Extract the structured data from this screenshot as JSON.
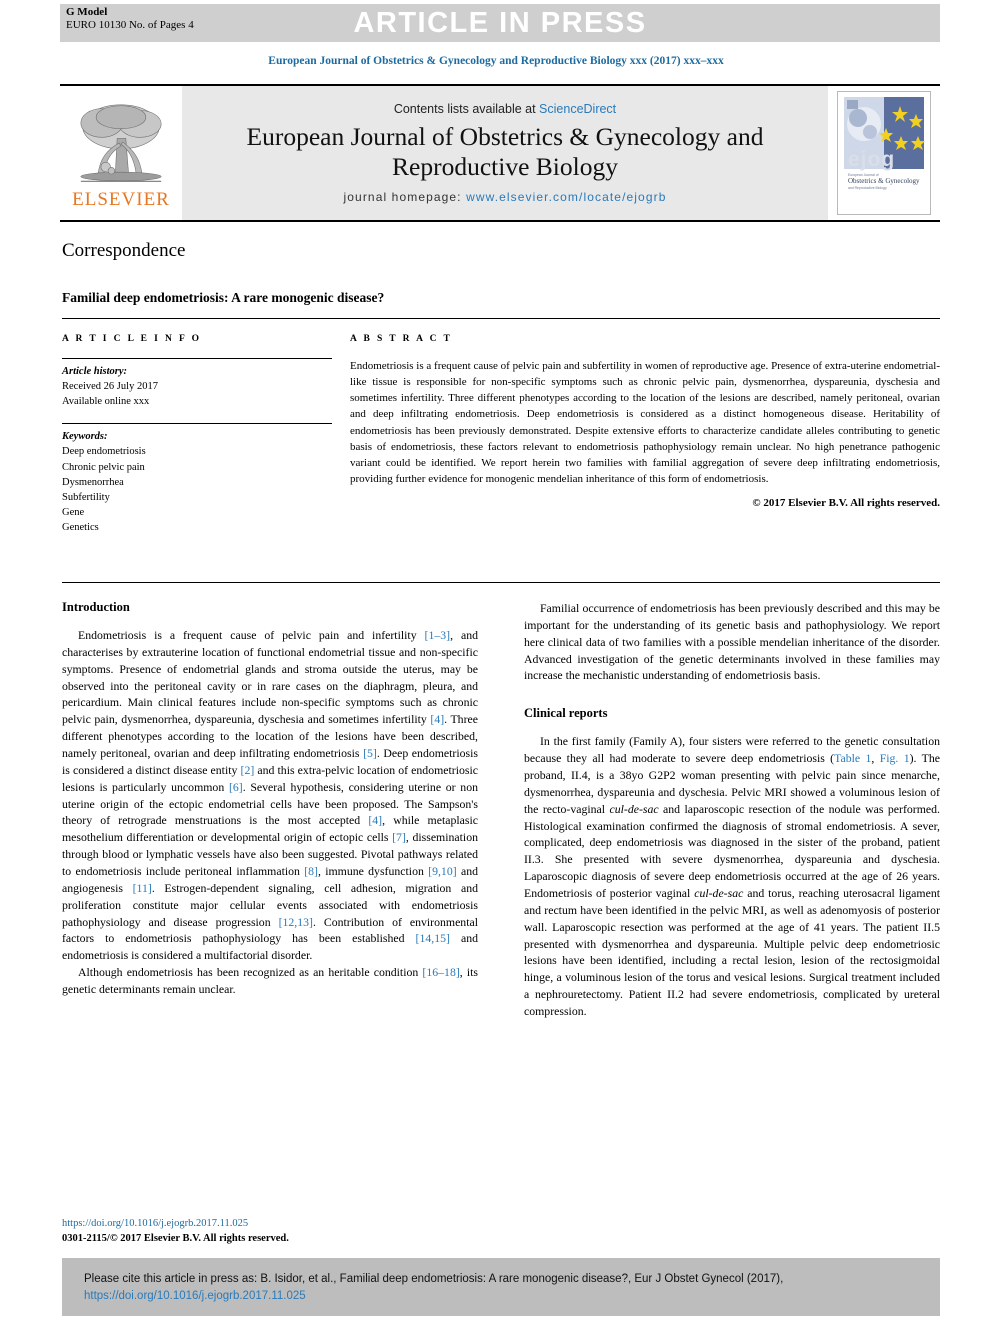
{
  "header": {
    "g_model_line1": "G Model",
    "g_model_line2": "EURO 10130 No. of Pages 4",
    "press_banner": "ARTICLE IN PRESS",
    "running_head": "European Journal of Obstetrics & Gynecology and Reproductive Biology xxx (2017) xxx–xxx"
  },
  "masthead": {
    "contents_prefix": "Contents lists available at ",
    "contents_link": "ScienceDirect",
    "journal_title_line1": "European Journal of Obstetrics & Gynecology and",
    "journal_title_line2": "Reproductive Biology",
    "homepage_label": "journal homepage: ",
    "homepage_url": "www.elsevier.com/locate/ejogrb",
    "publisher_wordmark": "ELSEVIER",
    "cover_wordmark": "ejog",
    "cover_sub1": "European Journal of",
    "cover_sub2": "Obstetrics & Gynecology",
    "cover_sub3": "and Reproductive Biology"
  },
  "article": {
    "section_kind": "Correspondence",
    "title": "Familial deep endometriosis: A rare monogenic disease?",
    "info_heading": "A R T I C L E   I N F O",
    "abstract_heading": "A B S T R A C T",
    "history_label": "Article history:",
    "history_received": "Received 26 July 2017",
    "history_online": "Available online xxx",
    "keywords_label": "Keywords:",
    "keywords": [
      "Deep endometriosis",
      "Chronic pelvic pain",
      "Dysmenorrhea",
      "Subfertility",
      "Gene",
      "Genetics"
    ],
    "abstract": "Endometriosis is a frequent cause of pelvic pain and subfertility in women of reproductive age. Presence of extra-uterine endometrial-like tissue is responsible for non-specific symptoms such as chronic pelvic pain, dysmenorrhea, dyspareunia, dyschesia and sometimes infertility. Three different phenotypes according to the location of the lesions are described, namely peritoneal, ovarian and deep infiltrating endometriosis. Deep endometriosis is considered as a distinct homogeneous disease. Heritability of endometriosis has been previously demonstrated. Despite extensive efforts to characterize candidate alleles contributing to genetic basis of endometriosis, these factors relevant to endometriosis pathophysiology remain unclear. No high penetrance pathogenic variant could be identified. We report herein two families with familial aggregation of severe deep infiltrating endometriosis, providing further evidence for monogenic mendelian inheritance of this form of endometriosis.",
    "copyright": "© 2017 Elsevier B.V. All rights reserved."
  },
  "body": {
    "left_heading": "Introduction",
    "intro_para1_a": "Endometriosis is a frequent cause of pelvic pain and infertility ",
    "intro_para1_ref1": "[1–3]",
    "intro_para1_b": ", and characterises by extrauterine location of functional endometrial tissue and non-specific symptoms. Presence of endometrial glands and stroma outside the uterus, may be observed into the peritoneal cavity or in rare cases on the diaphragm, pleura, and pericardium. Main clinical features include non-specific symptoms such as chronic pelvic pain, dysmenorrhea, dyspareunia, dyschesia and sometimes infertility ",
    "intro_ref4": "[4]",
    "intro_para1_c": ". Three different phenotypes according to the location of the lesions have been described, namely peritoneal, ovarian and deep infiltrating endometriosis ",
    "intro_ref5": "[5]",
    "intro_para1_d": ". Deep endometriosis is considered a distinct disease entity ",
    "intro_ref2": "[2]",
    "intro_para1_e": " and this extra-pelvic location of endometriosic lesions is particularly uncommon ",
    "intro_ref6": "[6]",
    "intro_para1_f": ". Several hypothesis, considering uterine or non uterine origin of the ectopic endometrial cells have been proposed. The Sampson's theory of retrograde menstruations is the most accepted ",
    "intro_ref4b": "[4]",
    "intro_para1_g": ", while metaplasic mesothelium differentiation or developmental origin of ectopic cells ",
    "intro_ref7": "[7]",
    "intro_para1_h": ", dissemination through blood or lymphatic vessels have also been suggested. Pivotal pathways related to endometriosis include peritoneal inflammation ",
    "intro_ref8": "[8]",
    "intro_para1_i": ", immune dysfunction ",
    "intro_ref910": "[9,10]",
    "intro_para1_j": " and angiogenesis ",
    "intro_ref11": "[11]",
    "intro_para1_k": ". Estrogen-dependent signaling, cell adhesion, migration and proliferation constitute major cellular events associated with endometriosis pathophysiology and disease progression ",
    "intro_ref1213": "[12,13]",
    "intro_para1_l": ". Contribution of environmental factors to endometriosis pathophysiology has been established ",
    "intro_ref1415": "[14,15]",
    "intro_para1_m": " and endometriosis is considered a multifactorial disorder.",
    "intro_para2_a": "Although endometriosis has been recognized as an heritable condition ",
    "intro_ref1618": "[16–18]",
    "intro_para2_b": ", its genetic determinants remain unclear.",
    "right_para1": "Familial occurrence of endometriosis has been previously described and this may be important for the understanding of its genetic basis and pathophysiology. We report here clinical data of two families with a possible mendelian inheritance of the disorder. Advanced investigation of the genetic determinants involved in these families may increase the mechanistic understanding of endometriosis basis.",
    "right_heading": "Clinical reports",
    "clin_a": "In the first family (Family A), four sisters were referred to the genetic consultation because they all had moderate to severe deep endometriosis (",
    "clin_link_table": "Table 1",
    "clin_sep": ", ",
    "clin_link_fig": "Fig. 1",
    "clin_b": "). The proband, II.4, is a 38yo G2P2 woman presenting with pelvic pain since menarche, dysmenorrhea, dyspareunia and dyschesia. Pelvic MRI showed a voluminous lesion of the recto-vaginal ",
    "clin_it1": "cul-de-sac",
    "clin_c": " and laparoscopic resection of the nodule was performed. Histological examination confirmed the diagnosis of stromal endometriosis. A sever, complicated, deep endometriosis was diagnosed in the sister of the proband, patient II.3. She presented with severe dysmenorrhea, dyspareunia and dyschesia. Laparoscopic diagnosis of severe deep endometriosis occurred at the age of 26 years. Endometriosis of posterior vaginal ",
    "clin_it2": "cul-de-sac",
    "clin_d": " and torus, reaching uterosacral ligament and rectum have been identified in the pelvic MRI, as well as adenomyosis of posterior wall. Laparoscopic resection was performed at the age of 41 years. The patient II.5 presented with dysmenorrhea and dyspareunia. Multiple pelvic deep endometriosic lesions have been identified, including a rectal lesion, lesion of the rectosigmoidal hinge, a voluminous lesion of the torus and vesical lesions. Surgical treatment included a nephrouretectomy. Patient II.2 had severe endometriosis, complicated by ureteral compression."
  },
  "footer": {
    "doi_link": "https://doi.org/10.1016/j.ejogrb.2017.11.025",
    "issn_line": "0301-2115/© 2017 Elsevier B.V. All rights reserved.",
    "cite_text": "Please cite this article in press as: B. Isidor, et al., Familial deep endometriosis: A rare monogenic disease?, Eur J Obstet Gynecol (2017), ",
    "cite_link": "https://doi.org/10.1016/j.ejogrb.2017.11.025"
  },
  "colors": {
    "link_blue": "#2a7ab9",
    "head_blue": "#1d6ba0",
    "elsevier_orange": "#E87722",
    "band_gray": "#cfcfcf",
    "mast_gray": "#e8e8e8",
    "cite_gray": "#bdbdbd"
  }
}
